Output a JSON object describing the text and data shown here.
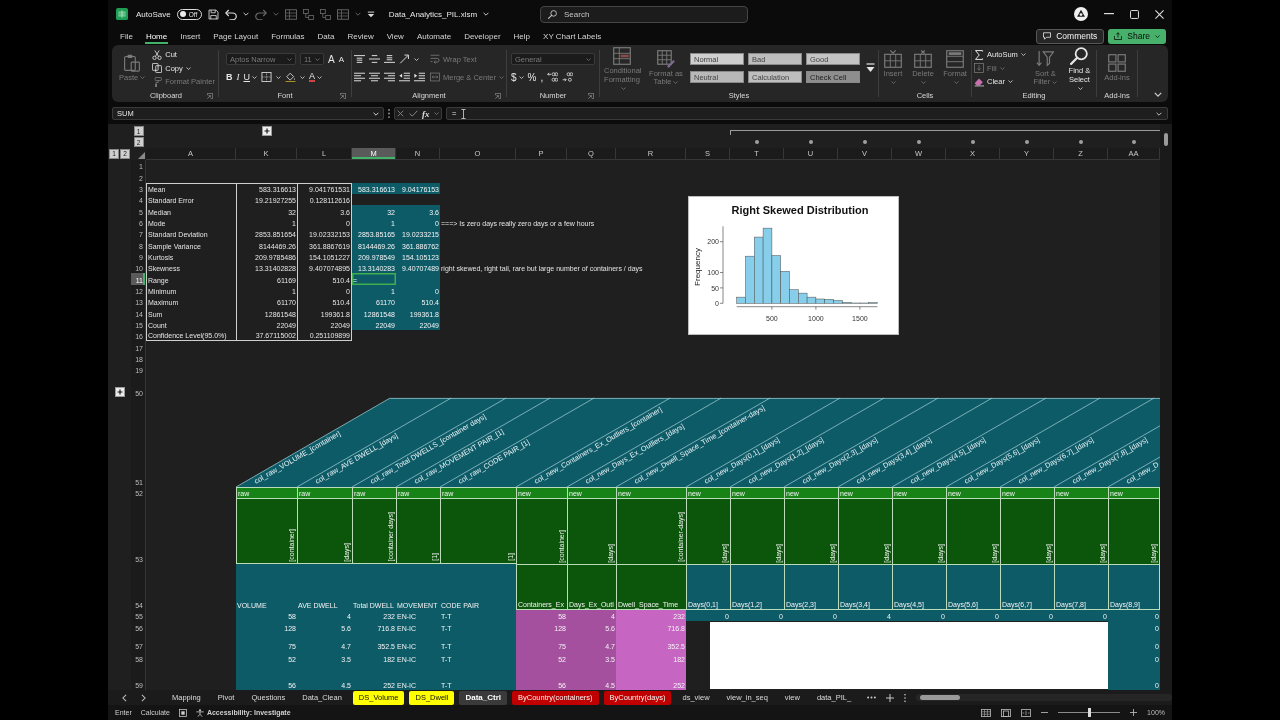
{
  "title_bar": {
    "autosave_label": "AutoSave",
    "autosave": {
      "on": false,
      "label": "Off"
    },
    "file_name": "Data_Analytics_PIL.xlsm",
    "search": {
      "placeholder": "Search"
    }
  },
  "menu_tabs": [
    {
      "label": "File",
      "selected": false
    },
    {
      "label": "Home",
      "selected": true
    },
    {
      "label": "Insert",
      "selected": false
    },
    {
      "label": "Page Layout",
      "selected": false
    },
    {
      "label": "Formulas",
      "selected": false
    },
    {
      "label": "Data",
      "selected": false
    },
    {
      "label": "Review",
      "selected": false
    },
    {
      "label": "View",
      "selected": false
    },
    {
      "label": "Automate",
      "selected": false
    },
    {
      "label": "Developer",
      "selected": false
    },
    {
      "label": "Help",
      "selected": false
    },
    {
      "label": "XY Chart Labels",
      "selected": false
    }
  ],
  "header_buttons": [
    {
      "label": "Comments",
      "kind": "outline"
    },
    {
      "label": "Share",
      "kind": "primary"
    }
  ],
  "ribbon": [
    {
      "name": "Clipboard",
      "launcher": true,
      "columns": [
        [
          [
            {
              "kind": "large",
              "label": "Paste",
              "disabled": true,
              "dropdown": true
            }
          ]
        ],
        [
          [
            {
              "kind": "small",
              "label": "Cut",
              "disabled": false
            }
          ],
          [
            {
              "kind": "small",
              "label": "Copy",
              "disabled": false,
              "dropdown": true
            }
          ],
          [
            {
              "kind": "small",
              "label": "Format Painter",
              "disabled": true
            }
          ]
        ]
      ]
    },
    {
      "name": "Font",
      "launcher": true,
      "columns": [
        [
          [
            {
              "kind": "field",
              "label": "Aptos Narrow",
              "disabled": true
            },
            {
              "kind": "field",
              "label": "11",
              "disabled": true
            },
            {
              "kind": "glyph",
              "label": "A",
              "disabled": false
            },
            {
              "kind": "glyph",
              "label": "A",
              "disabled": false
            }
          ],
          [
            {
              "kind": "glyph",
              "label": "B",
              "disabled": false
            },
            {
              "kind": "glyph",
              "label": "I",
              "disabled": false
            },
            {
              "kind": "glyph",
              "label": "U",
              "disabled": false,
              "dropdown": true
            },
            {
              "kind": "icon",
              "disabled": false,
              "dropdown": true
            },
            {
              "kind": "icon",
              "disabled": false,
              "dropdown": true
            },
            {
              "kind": "glyph",
              "label": "A",
              "disabled": false,
              "dropdown": true
            }
          ]
        ]
      ]
    },
    {
      "name": "Alignment",
      "launcher": true,
      "columns": [
        [
          [
            {
              "kind": "icon",
              "disabled": false
            },
            {
              "kind": "icon",
              "disabled": false
            },
            {
              "kind": "icon",
              "disabled": false
            },
            {
              "kind": "icon",
              "disabled": false,
              "dropdown": true
            }
          ],
          [
            {
              "kind": "icon",
              "disabled": false
            },
            {
              "kind": "icon",
              "disabled": false
            },
            {
              "kind": "icon",
              "disabled": false
            },
            {
              "kind": "icon",
              "disabled": false
            },
            {
              "kind": "icon",
              "disabled": false
            }
          ]
        ],
        [
          [
            {
              "kind": "small",
              "label": "Wrap Text",
              "disabled": true
            }
          ],
          [
            {
              "kind": "small",
              "label": "Merge & Center",
              "disabled": true,
              "dropdown": true
            }
          ]
        ]
      ]
    },
    {
      "name": "Number",
      "launcher": true,
      "columns": [
        [
          [
            {
              "kind": "field",
              "label": "General",
              "disabled": true
            }
          ],
          [
            {
              "kind": "glyph",
              "label": "$",
              "disabled": false,
              "dropdown": true
            },
            {
              "kind": "glyph",
              "label": "%",
              "disabled": false
            },
            {
              "kind": "glyph",
              "label": ",",
              "disabled": false
            },
            {
              "kind": "icon",
              "disabled": false
            },
            {
              "kind": "icon",
              "disabled": false
            }
          ]
        ]
      ]
    },
    {
      "name": "Styles",
      "launcher": false,
      "columns": [
        [
          [
            {
              "kind": "large",
              "label": "Conditional Formatting",
              "disabled": true,
              "dropdown": true
            }
          ]
        ],
        [
          [
            {
              "kind": "large",
              "label": "Format as Table",
              "disabled": true,
              "dropdown": true
            }
          ]
        ],
        [
          [
            {
              "kind": "style",
              "label": "Normal",
              "disabled": true
            },
            {
              "kind": "style",
              "label": "Bad",
              "disabled": true
            },
            {
              "kind": "style",
              "label": "Good",
              "disabled": true
            }
          ],
          [
            {
              "kind": "style",
              "label": "Neutral",
              "disabled": true
            },
            {
              "kind": "style",
              "label": "Calculation",
              "disabled": true
            },
            {
              "kind": "style",
              "label": "Check Cell",
              "disabled": true
            }
          ]
        ],
        [
          [
            {
              "kind": "icon",
              "disabled": false
            }
          ]
        ]
      ]
    },
    {
      "name": "Cells",
      "launcher": false,
      "columns": [
        [
          [
            {
              "kind": "large",
              "label": "Insert",
              "disabled": true,
              "dropdown": true
            }
          ]
        ],
        [
          [
            {
              "kind": "large",
              "label": "Delete",
              "disabled": true,
              "dropdown": true
            }
          ]
        ],
        [
          [
            {
              "kind": "large",
              "label": "Format",
              "disabled": true,
              "dropdown": true
            }
          ]
        ]
      ]
    },
    {
      "name": "Editing",
      "launcher": false,
      "columns": [
        [
          [
            {
              "kind": "small",
              "label": "AutoSum",
              "disabled": false,
              "dropdown": true
            }
          ],
          [
            {
              "kind": "small",
              "label": "Fill",
              "disabled": true,
              "dropdown": true
            }
          ],
          [
            {
              "kind": "small",
              "label": "Clear",
              "disabled": false,
              "dropdown": true
            }
          ]
        ],
        [
          [
            {
              "kind": "large",
              "label": "Sort & Filter",
              "disabled": true,
              "dropdown": true
            }
          ]
        ],
        [
          [
            {
              "kind": "large",
              "label": "Find & Select",
              "disabled": false,
              "dropdown": true
            }
          ]
        ]
      ]
    },
    {
      "name": "Add-ins",
      "launcher": false,
      "columns": [
        [
          [
            {
              "kind": "large",
              "label": "Add-ins",
              "disabled": true
            }
          ]
        ]
      ]
    }
  ],
  "formula_bar": {
    "name_box": "SUM",
    "fx": "fx",
    "formula": "="
  },
  "outline": {
    "row_levels": [
      "1",
      "2"
    ],
    "column_levels": [
      "1",
      "2"
    ],
    "rows_expanded": false,
    "columns_expanded": false
  },
  "sheet": {
    "columns": [
      {
        "label": "A",
        "selected": false
      },
      {
        "label": "K",
        "selected": false
      },
      {
        "label": "L",
        "selected": false
      },
      {
        "label": "M",
        "selected": true
      },
      {
        "label": "N",
        "selected": false
      },
      {
        "label": "O",
        "selected": false
      },
      {
        "label": "P",
        "selected": false
      },
      {
        "label": "Q",
        "selected": false
      },
      {
        "label": "R",
        "selected": false
      },
      {
        "label": "S",
        "selected": false
      },
      {
        "label": "T",
        "selected": false
      },
      {
        "label": "U",
        "selected": false
      },
      {
        "label": "V",
        "selected": false
      },
      {
        "label": "W",
        "selected": false
      },
      {
        "label": "X",
        "selected": false
      },
      {
        "label": "Y",
        "selected": false
      },
      {
        "label": "Z",
        "selected": false
      },
      {
        "label": "AA",
        "selected": false
      }
    ],
    "rows": [
      {
        "label": "1",
        "selected": false,
        "kind": "plain"
      },
      {
        "label": "2",
        "selected": false,
        "kind": "plain"
      },
      {
        "label": "3",
        "selected": false,
        "kind": "plain",
        "cells": [
          {
            "text": "Mean",
            "kind": "text",
            "bordered": true
          },
          {
            "text": "583.316613",
            "kind": "num",
            "bordered": true
          },
          {
            "text": "9.041761531",
            "kind": "num",
            "bordered": true
          },
          {
            "text": "583.316613",
            "kind": "num",
            "color": "#0e5b68"
          },
          {
            "text": "9.04176153",
            "kind": "num",
            "color": "#0e5b68"
          }
        ]
      },
      {
        "label": "4",
        "selected": false,
        "kind": "plain",
        "cells": [
          {
            "text": "Standard Error",
            "kind": "text",
            "bordered": true
          },
          {
            "text": "19.21927255",
            "kind": "num",
            "bordered": true
          },
          {
            "text": "0.128112616",
            "kind": "num",
            "bordered": true
          }
        ]
      },
      {
        "label": "5",
        "selected": false,
        "kind": "plain",
        "cells": [
          {
            "text": "Median",
            "kind": "text",
            "bordered": true
          },
          {
            "text": "32",
            "kind": "num",
            "bordered": true
          },
          {
            "text": "3.6",
            "kind": "num",
            "bordered": true
          },
          {
            "text": "32",
            "kind": "num",
            "color": "#0e5b68"
          },
          {
            "text": "3.6",
            "kind": "num",
            "color": "#0e5b68"
          }
        ]
      },
      {
        "label": "6",
        "selected": false,
        "kind": "plain",
        "cells": [
          {
            "text": "Mode",
            "kind": "text",
            "bordered": true
          },
          {
            "text": "1",
            "kind": "num",
            "bordered": true
          },
          {
            "text": "0",
            "kind": "num",
            "bordered": true
          },
          {
            "text": "1",
            "kind": "num",
            "color": "#0e5b68"
          },
          {
            "text": "0",
            "kind": "num",
            "color": "#0e5b68"
          },
          {
            "text": "===> Is zero days really zero days or a few hours",
            "kind": "text"
          }
        ]
      },
      {
        "label": "7",
        "selected": false,
        "kind": "plain",
        "cells": [
          {
            "text": "Standard Deviation",
            "kind": "text",
            "bordered": true
          },
          {
            "text": "2853.851654",
            "kind": "num",
            "bordered": true
          },
          {
            "text": "19.02332153",
            "kind": "num",
            "bordered": true
          },
          {
            "text": "2853.85165",
            "kind": "num",
            "color": "#0e5b68"
          },
          {
            "text": "19.0233215",
            "kind": "num",
            "color": "#0e5b68"
          }
        ]
      },
      {
        "label": "8",
        "selected": false,
        "kind": "plain",
        "cells": [
          {
            "text": "Sample Variance",
            "kind": "text",
            "bordered": true
          },
          {
            "text": "8144469.26",
            "kind": "num",
            "bordered": true
          },
          {
            "text": "361.8867619",
            "kind": "num",
            "bordered": true
          },
          {
            "text": "8144469.26",
            "kind": "num",
            "color": "#0e5b68"
          },
          {
            "text": "361.886762",
            "kind": "num",
            "color": "#0e5b68"
          }
        ]
      },
      {
        "label": "9",
        "selected": false,
        "kind": "plain",
        "cells": [
          {
            "text": "Kurtosis",
            "kind": "text",
            "bordered": true
          },
          {
            "text": "209.9785486",
            "kind": "num",
            "bordered": true
          },
          {
            "text": "154.1051227",
            "kind": "num",
            "bordered": true
          },
          {
            "text": "209.978549",
            "kind": "num",
            "color": "#0e5b68"
          },
          {
            "text": "154.105123",
            "kind": "num",
            "color": "#0e5b68"
          }
        ]
      },
      {
        "label": "10",
        "selected": false,
        "kind": "plain",
        "cells": [
          {
            "text": "Skewness",
            "kind": "text",
            "bordered": true
          },
          {
            "text": "13.31402828",
            "kind": "num",
            "bordered": true
          },
          {
            "text": "9.407074895",
            "kind": "num",
            "bordered": true
          },
          {
            "text": "13.3140283",
            "kind": "num",
            "color": "#0e5b68"
          },
          {
            "text": "9.40707489",
            "kind": "num",
            "color": "#0e5b68"
          },
          {
            "text": "right skewed, right tail, rare but large number of containers / days",
            "kind": "text"
          }
        ]
      },
      {
        "label": "11",
        "selected": true,
        "kind": "plain",
        "cells": [
          {
            "text": "Range",
            "kind": "text",
            "bordered": true
          },
          {
            "text": "61169",
            "kind": "num",
            "bordered": true
          },
          {
            "text": "510.4",
            "kind": "num",
            "bordered": true
          },
          {
            "text": "=",
            "kind": "text",
            "color": "#0e5b68"
          },
          {
            "kind": "num",
            "color": "#0e5b68"
          }
        ]
      },
      {
        "label": "12",
        "selected": false,
        "kind": "plain",
        "cells": [
          {
            "text": "Minimum",
            "kind": "text",
            "bordered": true
          },
          {
            "text": "1",
            "kind": "num",
            "bordered": true
          },
          {
            "text": "0",
            "kind": "num",
            "bordered": true
          },
          {
            "text": "1",
            "kind": "num",
            "color": "#0e5b68"
          },
          {
            "text": "0",
            "kind": "num",
            "color": "#0e5b68"
          }
        ]
      },
      {
        "label": "13",
        "selected": false,
        "kind": "plain",
        "cells": [
          {
            "text": "Maximum",
            "kind": "text",
            "bordered": true
          },
          {
            "text": "61170",
            "kind": "num",
            "bordered": true
          },
          {
            "text": "510.4",
            "kind": "num",
            "bordered": true
          },
          {
            "text": "61170",
            "kind": "num",
            "color": "#0e5b68"
          },
          {
            "text": "510.4",
            "kind": "num",
            "color": "#0e5b68"
          }
        ]
      },
      {
        "label": "14",
        "selected": false,
        "kind": "plain",
        "cells": [
          {
            "text": "Sum",
            "kind": "text",
            "bordered": true
          },
          {
            "text": "12861548",
            "kind": "num",
            "bordered": true
          },
          {
            "text": "199361.8",
            "kind": "num",
            "bordered": true
          },
          {
            "text": "12861548",
            "kind": "num",
            "color": "#0e5b68"
          },
          {
            "text": "199361.8",
            "kind": "num",
            "color": "#0e5b68"
          }
        ]
      },
      {
        "label": "15",
        "selected": false,
        "kind": "plain",
        "cells": [
          {
            "text": "Count",
            "kind": "text",
            "bordered": true
          },
          {
            "text": "22049",
            "kind": "num",
            "bordered": true
          },
          {
            "text": "22049",
            "kind": "num",
            "bordered": true
          },
          {
            "text": "22049",
            "kind": "num",
            "color": "#0e5b68"
          },
          {
            "text": "22049",
            "kind": "num",
            "color": "#0e5b68"
          }
        ]
      },
      {
        "label": "16",
        "selected": false,
        "kind": "plain",
        "cells": [
          {
            "text": "Confidence Level(95.0%)",
            "kind": "text",
            "bordered": true
          },
          {
            "text": "37.67115002",
            "kind": "num",
            "bordered": true
          },
          {
            "text": "0.251109899",
            "kind": "num",
            "bordered": true
          }
        ]
      },
      {
        "label": "17",
        "selected": false,
        "kind": "plain"
      },
      {
        "label": "18",
        "selected": false,
        "kind": "plain"
      },
      {
        "label": "19",
        "selected": false,
        "kind": "plain"
      },
      {
        "label": "50",
        "selected": false,
        "kind": "plain"
      },
      {
        "label": "51",
        "selected": false,
        "kind": "slanted_headers",
        "cells": [
          null,
          {
            "text": "col_raw_VOLUME_[container]"
          },
          {
            "text": "col_raw_AVE DWELL_[days]"
          },
          {
            "text": "col_raw_Total DWELLS_[container days]"
          },
          {
            "text": "col_raw_MOVEMENT PAIR_[1]"
          },
          {
            "text": "col_raw_CODE PAIR_[1]"
          },
          {
            "text": "col_new_Containers_Ex_Outliers_[container]"
          },
          {
            "text": "col_new_Days_Ex_Outliers_[days]"
          },
          {
            "text": "col_new_Dwell_Space_Time_[container-days]"
          },
          {
            "text": "col_new_Days(0,1]_[days]"
          },
          {
            "text": "col_new_Days(1,2]_[days]"
          },
          {
            "text": "col_new_Days(2,3]_[days]"
          },
          {
            "text": "col_new_Days(3,4]_[days]"
          },
          {
            "text": "col_new_Days(4,5]_[days]"
          },
          {
            "text": "col_new_Days(5,6]_[days]"
          },
          {
            "text": "col_new_Days(6,7]_[days]"
          },
          {
            "text": "col_new_Days(7,8]_[days]"
          },
          {
            "text": "col_new_D"
          }
        ]
      },
      {
        "label": "52",
        "selected": false,
        "kind": "plain",
        "cells": [
          null,
          {
            "text": "raw",
            "kind": "text",
            "color": "#178317",
            "bordered": true
          },
          {
            "text": "raw",
            "kind": "text",
            "color": "#178317",
            "bordered": true
          },
          {
            "text": "raw",
            "kind": "text",
            "color": "#178317",
            "bordered": true
          },
          {
            "text": "raw",
            "kind": "text",
            "color": "#178317",
            "bordered": true
          },
          {
            "text": "raw",
            "kind": "text",
            "color": "#178317",
            "bordered": true
          },
          {
            "text": "new",
            "kind": "text",
            "color": "#178317",
            "bordered": true
          },
          {
            "text": "new",
            "kind": "text",
            "color": "#178317",
            "bordered": true
          },
          {
            "text": "new",
            "kind": "text",
            "color": "#178317",
            "bordered": true
          },
          {
            "text": "new",
            "kind": "text",
            "color": "#178317",
            "bordered": true
          },
          {
            "text": "new",
            "kind": "text",
            "color": "#178317",
            "bordered": true
          },
          {
            "text": "new",
            "kind": "text",
            "color": "#178317",
            "bordered": true
          },
          {
            "text": "new",
            "kind": "text",
            "color": "#178317",
            "bordered": true
          },
          {
            "text": "new",
            "kind": "text",
            "color": "#178317",
            "bordered": true
          },
          {
            "text": "new",
            "kind": "text",
            "color": "#178317",
            "bordered": true
          },
          {
            "text": "new",
            "kind": "text",
            "color": "#178317",
            "bordered": true
          },
          {
            "text": "new",
            "kind": "text",
            "color": "#178317",
            "bordered": true
          },
          {
            "text": "new",
            "kind": "text",
            "color": "#178317",
            "bordered": true
          }
        ]
      },
      {
        "label": "53",
        "selected": false,
        "kind": "plain",
        "cells": [
          null,
          {
            "text": "[container]",
            "kind": "vertical",
            "color": "#0b560b",
            "bordered": true
          },
          {
            "text": "[days]",
            "kind": "vertical",
            "color": "#0b560b",
            "bordered": true
          },
          {
            "text": "[container days]",
            "kind": "vertical",
            "color": "#0b560b",
            "bordered": true
          },
          {
            "text": "[1]",
            "kind": "vertical",
            "color": "#0b560b",
            "bordered": true
          },
          {
            "text": "[1]",
            "kind": "vertical",
            "color": "#0b560b",
            "bordered": true
          },
          {
            "text": "[container]",
            "kind": "vertical",
            "color": "#0b560b",
            "bordered": true
          },
          {
            "text": "[days]",
            "kind": "vertical",
            "color": "#0b560b",
            "bordered": true
          },
          {
            "text": "[container-days]",
            "kind": "vertical",
            "color": "#0b560b",
            "bordered": true
          },
          {
            "text": "[days]",
            "kind": "vertical",
            "color": "#0b560b",
            "bordered": true
          },
          {
            "text": "[days]",
            "kind": "vertical",
            "color": "#0b560b",
            "bordered": true
          },
          {
            "text": "[days]",
            "kind": "vertical",
            "color": "#0b560b",
            "bordered": true
          },
          {
            "text": "[days]",
            "kind": "vertical",
            "color": "#0b560b",
            "bordered": true
          },
          {
            "text": "[days]",
            "kind": "vertical",
            "color": "#0b560b",
            "bordered": true
          },
          {
            "text": "[days]",
            "kind": "vertical",
            "color": "#0b560b",
            "bordered": true
          },
          {
            "text": "[days]",
            "kind": "vertical",
            "color": "#0b560b",
            "bordered": true
          },
          {
            "text": "[days]",
            "kind": "vertical",
            "color": "#0b560b",
            "bordered": true
          },
          {
            "text": "[days]",
            "kind": "vertical",
            "color": "#0b560b",
            "bordered": true
          }
        ]
      },
      {
        "label": "54",
        "selected": false,
        "kind": "plain",
        "cells": [
          null,
          {
            "text": "VOLUME",
            "kind": "text",
            "color": "#0e5b68"
          },
          {
            "text": "AVE DWELL",
            "kind": "text",
            "color": "#0e5b68"
          },
          {
            "text": "Total DWELL",
            "kind": "text",
            "color": "#0e5b68"
          },
          {
            "text": "MOVEMENT",
            "kind": "text",
            "color": "#0e5b68"
          },
          {
            "text": "CODE PAIR",
            "kind": "text",
            "color": "#0e5b68"
          },
          {
            "text": "Containers_Ex",
            "kind": "text",
            "color": "#0b560b",
            "bordered": true
          },
          {
            "text": "Days_Ex_Outl",
            "kind": "text",
            "color": "#0b560b",
            "bordered": true
          },
          {
            "text": "Dwell_Space_Time",
            "kind": "text",
            "color": "#0b560b",
            "bordered": true
          },
          {
            "text": "Days(0,1]",
            "kind": "text",
            "color": "#0e5b68",
            "bordered": true
          },
          {
            "text": "Days(1,2]",
            "kind": "text",
            "color": "#0e5b68",
            "bordered": true
          },
          {
            "text": "Days(2,3]",
            "kind": "text",
            "color": "#0e5b68",
            "bordered": true
          },
          {
            "text": "Days(3,4]",
            "kind": "text",
            "color": "#0e5b68",
            "bordered": true
          },
          {
            "text": "Days(4,5]",
            "kind": "text",
            "color": "#0e5b68",
            "bordered": true
          },
          {
            "text": "Days(5,6]",
            "kind": "text",
            "color": "#0e5b68",
            "bordered": true
          },
          {
            "text": "Days(6,7]",
            "kind": "text",
            "color": "#0e5b68",
            "bordered": true
          },
          {
            "text": "Days(7,8]",
            "kind": "text",
            "color": "#0e5b68",
            "bordered": true
          },
          {
            "text": "Days(8,9]",
            "kind": "text",
            "color": "#0e5b68",
            "bordered": true
          }
        ]
      },
      {
        "label": "55",
        "selected": false,
        "kind": "plain",
        "cells": [
          null,
          {
            "text": "58",
            "kind": "num",
            "color": "#0e5b68"
          },
          {
            "text": "4",
            "kind": "num",
            "color": "#0e5b68"
          },
          {
            "text": "232",
            "kind": "num",
            "color": "#0e5b68"
          },
          {
            "text": "EN-IC",
            "kind": "text",
            "color": "#0e5b68"
          },
          {
            "text": "T-T",
            "kind": "text",
            "color": "#0e5b68"
          },
          {
            "text": "58",
            "kind": "num",
            "color": "#a5509f"
          },
          {
            "text": "4",
            "kind": "num",
            "color": "#a5509f"
          },
          {
            "text": "232",
            "kind": "num",
            "color": "#c765c2"
          },
          {
            "text": "0",
            "kind": "num",
            "color": "#0e5b68"
          },
          {
            "text": "0",
            "kind": "num",
            "color": "#0e5b68"
          },
          {
            "text": "0",
            "kind": "num",
            "color": "#0e5b68"
          },
          {
            "text": "4",
            "kind": "num",
            "color": "#0e5b68"
          },
          {
            "text": "0",
            "kind": "num",
            "color": "#0e5b68"
          },
          {
            "text": "0",
            "kind": "num",
            "color": "#0e5b68"
          },
          {
            "text": "0",
            "kind": "num",
            "color": "#0e5b68"
          },
          {
            "text": "0",
            "kind": "num",
            "color": "#0e5b68"
          },
          {
            "text": "0",
            "kind": "num",
            "color": "#0e5b68"
          }
        ]
      },
      {
        "label": "56",
        "selected": false,
        "kind": "plain",
        "cells": [
          null,
          {
            "text": "128",
            "kind": "num",
            "color": "#0e5b68"
          },
          {
            "text": "5.6",
            "kind": "num",
            "color": "#0e5b68"
          },
          {
            "text": "716.8",
            "kind": "num",
            "color": "#0e5b68"
          },
          {
            "text": "EN-IC",
            "kind": "text",
            "color": "#0e5b68"
          },
          {
            "text": "T-T",
            "kind": "text",
            "color": "#0e5b68"
          },
          {
            "text": "128",
            "kind": "num",
            "color": "#a5509f"
          },
          {
            "text": "5.6",
            "kind": "num",
            "color": "#a5509f"
          },
          {
            "text": "716.8",
            "kind": "num",
            "color": "#c765c2"
          },
          null,
          null,
          null,
          null,
          null,
          null,
          null,
          null,
          {
            "text": "0",
            "kind": "num",
            "color": "#0e5b68"
          }
        ]
      },
      {
        "label": "57",
        "selected": false,
        "kind": "plain",
        "cells": [
          null,
          {
            "text": "75",
            "kind": "num",
            "color": "#0e5b68"
          },
          {
            "text": "4.7",
            "kind": "num",
            "color": "#0e5b68"
          },
          {
            "text": "352.5",
            "kind": "num",
            "color": "#0e5b68"
          },
          {
            "text": "EN-IC",
            "kind": "text",
            "color": "#0e5b68"
          },
          {
            "text": "T-T",
            "kind": "text",
            "color": "#0e5b68"
          },
          {
            "text": "75",
            "kind": "num",
            "color": "#a5509f"
          },
          {
            "text": "4.7",
            "kind": "num",
            "color": "#a5509f"
          },
          {
            "text": "352.5",
            "kind": "num",
            "color": "#c765c2"
          },
          null,
          null,
          null,
          null,
          null,
          null,
          null,
          null,
          {
            "text": "0",
            "kind": "num",
            "color": "#0e5b68"
          }
        ]
      },
      {
        "label": "58",
        "selected": false,
        "kind": "plain",
        "cells": [
          null,
          {
            "text": "52",
            "kind": "num",
            "color": "#0e5b68"
          },
          {
            "text": "3.5",
            "kind": "num",
            "color": "#0e5b68"
          },
          {
            "text": "182",
            "kind": "num",
            "color": "#0e5b68"
          },
          {
            "text": "EN-IC",
            "kind": "text",
            "color": "#0e5b68"
          },
          {
            "text": "T-T",
            "kind": "text",
            "color": "#0e5b68"
          },
          {
            "text": "52",
            "kind": "num",
            "color": "#a5509f"
          },
          {
            "text": "3.5",
            "kind": "num",
            "color": "#a5509f"
          },
          {
            "text": "182",
            "kind": "num",
            "color": "#c765c2"
          },
          null,
          null,
          null,
          null,
          null,
          null,
          null,
          null,
          {
            "text": "0",
            "kind": "num",
            "color": "#0e5b68"
          }
        ]
      },
      {
        "label": "59",
        "selected": false,
        "kind": "plain",
        "cells": [
          null,
          {
            "text": "56",
            "kind": "num",
            "color": "#0e5b68"
          },
          {
            "text": "4.5",
            "kind": "num",
            "color": "#0e5b68"
          },
          {
            "text": "252",
            "kind": "num",
            "color": "#0e5b68"
          },
          {
            "text": "EN-IC",
            "kind": "text",
            "color": "#0e5b68"
          },
          {
            "text": "T-T",
            "kind": "text",
            "color": "#0e5b68"
          },
          {
            "text": "56",
            "kind": "num",
            "color": "#a5509f"
          },
          {
            "text": "4.5",
            "kind": "num",
            "color": "#a5509f"
          },
          {
            "text": "252",
            "kind": "num",
            "color": "#c765c2"
          },
          null,
          null,
          null,
          null,
          null,
          null,
          null,
          null,
          {
            "text": "0",
            "kind": "num",
            "color": "#0e5b68"
          }
        ]
      }
    ]
  },
  "chart": {
    "chart_data": {
      "type": "bar",
      "title": "Right Skewed Distribution",
      "ylabel": "Frequency",
      "x": [
        150,
        250,
        350,
        450,
        550,
        650,
        750,
        850,
        950,
        1050,
        1150,
        1250,
        1350,
        1450,
        1550,
        1650
      ],
      "values": [
        20,
        153,
        215,
        244,
        155,
        104,
        44,
        33,
        20,
        14,
        13,
        9,
        3,
        1,
        1,
        2
      ],
      "xlim": [
        100,
        1700
      ],
      "ylim": [
        0,
        250
      ],
      "xticks": [
        500,
        1000,
        1500
      ],
      "yticks": [
        0,
        50,
        100,
        200
      ]
    }
  },
  "sheet_tabs": [
    {
      "label": "Mapping",
      "selected": false
    },
    {
      "label": "Pivot",
      "selected": false
    },
    {
      "label": "Questions",
      "selected": false
    },
    {
      "label": "Data_Clean",
      "selected": false
    },
    {
      "label": "DS_Volume",
      "selected": false,
      "color": "#ffff00"
    },
    {
      "label": "DS_Dwell",
      "selected": false,
      "color": "#ffff00"
    },
    {
      "label": "Data_Ctrl",
      "selected": true
    },
    {
      "label": "ByCountry(containers)",
      "selected": false,
      "color": "#c00000"
    },
    {
      "label": "ByCountry(days)",
      "selected": false,
      "color": "#c00000"
    },
    {
      "label": "ds_view",
      "selected": false
    },
    {
      "label": "view_in_seq",
      "selected": false
    },
    {
      "label": "view",
      "selected": false
    },
    {
      "label": "data_PIL_",
      "selected": false
    }
  ],
  "status_bar": {
    "mode": "Enter",
    "calculate": "Calculate",
    "accessibility": "Accessibility: Investigate",
    "zoom": {
      "level": 0.5,
      "label": "100%"
    }
  }
}
